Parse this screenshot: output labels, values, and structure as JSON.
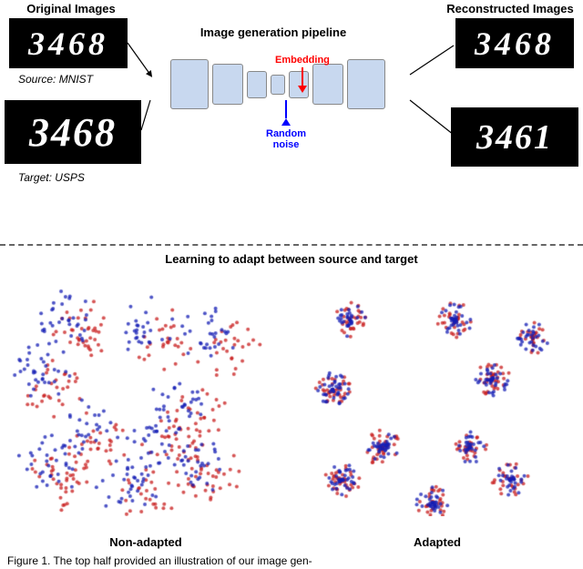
{
  "top": {
    "original_label": "Original Images",
    "reconstructed_label": "Reconstructed Images",
    "source_label": "Source: MNIST",
    "target_label": "Target: USPS",
    "pipeline_label": "Image generation pipeline",
    "embedding_label": "Embedding",
    "noise_label": "Random\nnoise",
    "mnist_digits": "3468",
    "usps_digits": "3468",
    "recon_top_digits": "3468",
    "recon_bottom_digits": "3461"
  },
  "bottom": {
    "adapt_label": "Learning to adapt between source and target",
    "non_adapted_label": "Non-adapted",
    "adapted_label": "Adapted"
  },
  "caption": {
    "text": "Figure 1. The top half provided an illustration of our image gen-"
  }
}
